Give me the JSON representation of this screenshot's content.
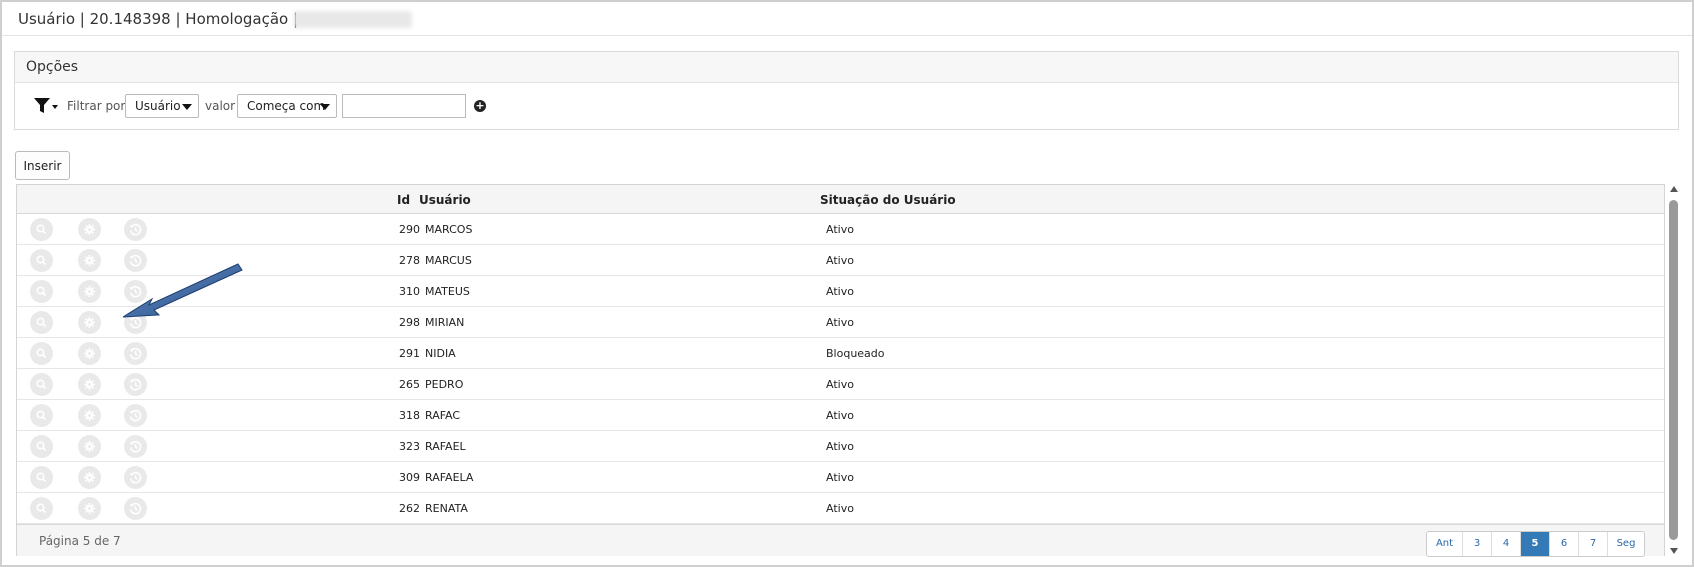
{
  "window": {
    "title": "Usuário | 20.148398 | Homologação |"
  },
  "options": {
    "heading": "Opções",
    "filter_by_label": "Filtrar por",
    "field_select_value": "Usuário",
    "value_label": "valor",
    "operator_select_value": "Começa com",
    "filter_value": "",
    "funnel_icon": "filter-funnel-icon",
    "add_icon": "plus-circle-icon"
  },
  "toolbar": {
    "insert_label": "Inserir"
  },
  "table": {
    "columns": {
      "id": "Id",
      "user": "Usuário",
      "status": "Situação do Usuário"
    },
    "row_icons": [
      "search-icon",
      "gear-icon",
      "history-icon"
    ],
    "rows": [
      {
        "id": "290",
        "user": "MARCOS",
        "status": "Ativo"
      },
      {
        "id": "278",
        "user": "MARCUS",
        "status": "Ativo"
      },
      {
        "id": "310",
        "user": "MATEUS",
        "status": "Ativo"
      },
      {
        "id": "298",
        "user": "MIRIAN",
        "status": "Ativo"
      },
      {
        "id": "291",
        "user": "NIDIA",
        "status": "Bloqueado"
      },
      {
        "id": "265",
        "user": "PEDRO",
        "status": "Ativo"
      },
      {
        "id": "318",
        "user": "RAFAC",
        "status": "Ativo"
      },
      {
        "id": "323",
        "user": "RAFAEL",
        "status": "Ativo"
      },
      {
        "id": "309",
        "user": "RAFAELA",
        "status": "Ativo"
      },
      {
        "id": "262",
        "user": "RENATA",
        "status": "Ativo"
      }
    ]
  },
  "pagination": {
    "info": "Página 5 de 7",
    "prev": "Ant",
    "next": "Seg",
    "pages": [
      "3",
      "4",
      "5",
      "6",
      "7"
    ],
    "current": "5"
  },
  "colors": {
    "accent": "#337ab7",
    "annotation_arrow": "#1f4e8c"
  }
}
